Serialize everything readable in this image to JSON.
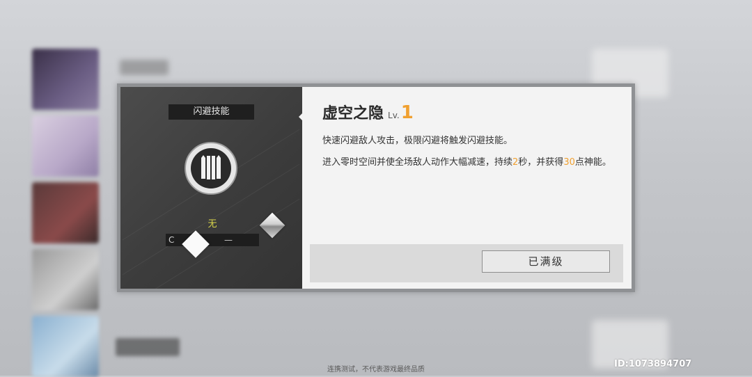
{
  "skill_type_label": "闪避技能",
  "skill": {
    "name": "虚空之隐",
    "level_label": "Lv.",
    "level_value": "1",
    "desc_line1": "快速闪避敌人攻击，极限闪避将触发闪避技能。",
    "desc_part1": "进入零时空间并使全场敌人动作大幅减速，持续",
    "duration": "2",
    "desc_part2": "秒，并获得",
    "energy": "30",
    "desc_part3": "点神能。"
  },
  "cost": {
    "value_text": "无",
    "bar_label": "C",
    "bar_value": "—"
  },
  "maxed_button_label": "已满级",
  "footer_note": "连携测试，不代表游戏最终品质",
  "user_id": "ID:1073894707",
  "colors": {
    "accent": "#f0a030",
    "cost_text": "#d8d54a",
    "panel_dark": "#3c3c3c",
    "panel_light": "#f3f3f3"
  },
  "icons": {
    "skill_icon": "void-slash-icon",
    "diamond_small": "diamond-icon",
    "diamond_silver": "crystal-icon"
  }
}
